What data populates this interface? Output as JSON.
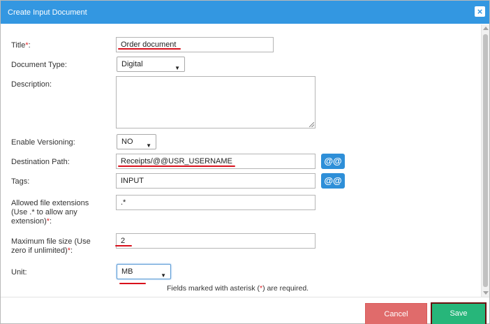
{
  "dialog": {
    "title": "Create Input Document",
    "close_icon": "close-icon"
  },
  "form": {
    "title": {
      "label": "Title",
      "value": "Order document"
    },
    "document_type": {
      "label": "Document Type:",
      "value": "Digital"
    },
    "description": {
      "label": "Description:",
      "value": ""
    },
    "enable_versioning": {
      "label": "Enable Versioning:",
      "value": "NO"
    },
    "destination_path": {
      "label": "Destination Path:",
      "value": "Receipts/@@USR_USERNAME",
      "button": "@@"
    },
    "tags": {
      "label": "Tags:",
      "value": "INPUT",
      "button": "@@"
    },
    "allowed_ext": {
      "label_line1": "Allowed file extensions",
      "label_line2": "(Use .* to allow any",
      "label_line3": "extension)",
      "value": ".*"
    },
    "max_size": {
      "label_line1": "Maximum file size (Use",
      "label_line2": "zero if unlimited)",
      "value": "2"
    },
    "unit": {
      "label": "Unit:",
      "value": "MB"
    },
    "required_mark": "*",
    "required_suffix": ":"
  },
  "note": {
    "prefix": "Fields marked with asterisk (",
    "star": "*",
    "suffix": ") are required."
  },
  "footer": {
    "cancel_label": "Cancel",
    "save_label": "Save"
  },
  "colors": {
    "titlebar": "#3397e1",
    "required": "#e0262a",
    "at_button": "#2e8fd8",
    "cancel": "#e06b6b",
    "save": "#27b67a",
    "annotation": "#d8101b"
  }
}
